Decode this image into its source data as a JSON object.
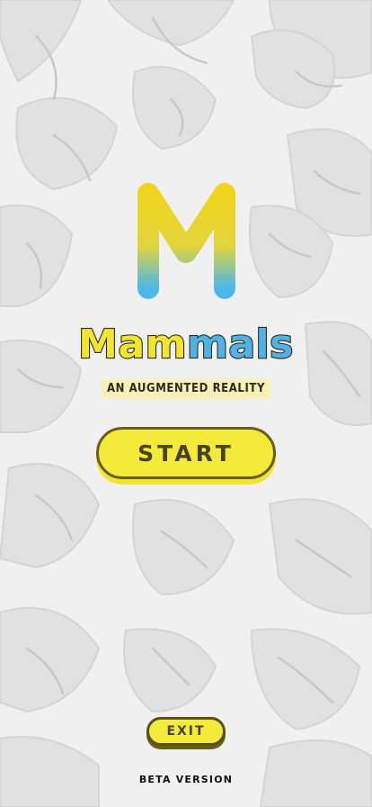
{
  "app": {
    "title_part1": "Mam",
    "title_part2": "mals",
    "logo_letter": "M",
    "subtitle": "AN AUGMENTED REALITY"
  },
  "buttons": {
    "start_label": "START",
    "exit_label": "EXIT"
  },
  "footer": {
    "version_label": "BETA VERSION"
  },
  "colors": {
    "accent_yellow": "#f4ea3a",
    "accent_blue": "#4fb3e6",
    "outline_dark": "#6a5d1b",
    "background": "#e9e9e9"
  },
  "background": {
    "icon": "animal-lineart-pattern"
  }
}
